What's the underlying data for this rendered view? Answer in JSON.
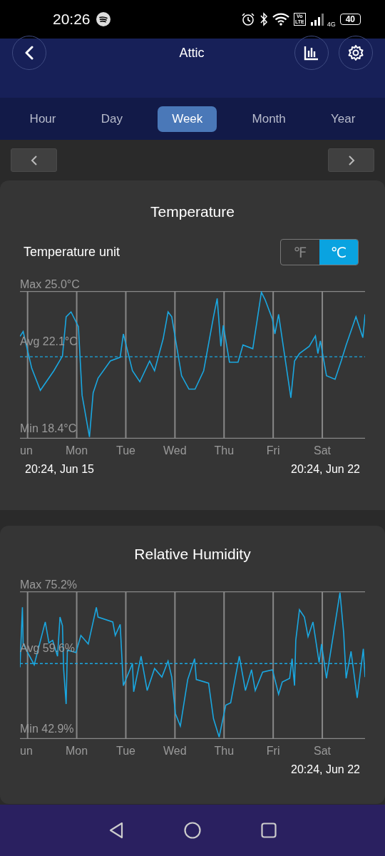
{
  "status_bar": {
    "time": "20:26",
    "volte_top": "Vo",
    "volte_bottom": "LTE",
    "network": "4G",
    "battery": "40"
  },
  "header": {
    "title": "Attic"
  },
  "tabs": [
    {
      "label": "Hour",
      "selected": false
    },
    {
      "label": "Day",
      "selected": false
    },
    {
      "label": "Week",
      "selected": true
    },
    {
      "label": "Month",
      "selected": false
    },
    {
      "label": "Year",
      "selected": false
    }
  ],
  "cards": [
    {
      "kind": "temperature",
      "title": "Temperature",
      "unit_label": "Temperature unit",
      "unit_options": [
        {
          "label": "℉",
          "selected": false
        },
        {
          "label": "℃",
          "selected": true
        }
      ],
      "max_label": "Max 25.0°C",
      "avg_label": "Avg 22.1°C",
      "min_label": "Min 18.4°C",
      "day_labels": [
        "un",
        "Mon",
        "Tue",
        "Wed",
        "Thu",
        "Fri",
        "Sat"
      ],
      "start_date": "20:24, Jun 15",
      "end_date": "20:24, Jun 22"
    },
    {
      "kind": "humidity",
      "title": "Relative Humidity",
      "max_label": "Max 75.2%",
      "avg_label": "Avg 59.6%",
      "min_label": "Min 42.9%",
      "day_labels": [
        "un",
        "Mon",
        "Tue",
        "Wed",
        "Thu",
        "Fri",
        "Sat"
      ],
      "end_date": "20:24, Jun 22"
    }
  ]
}
